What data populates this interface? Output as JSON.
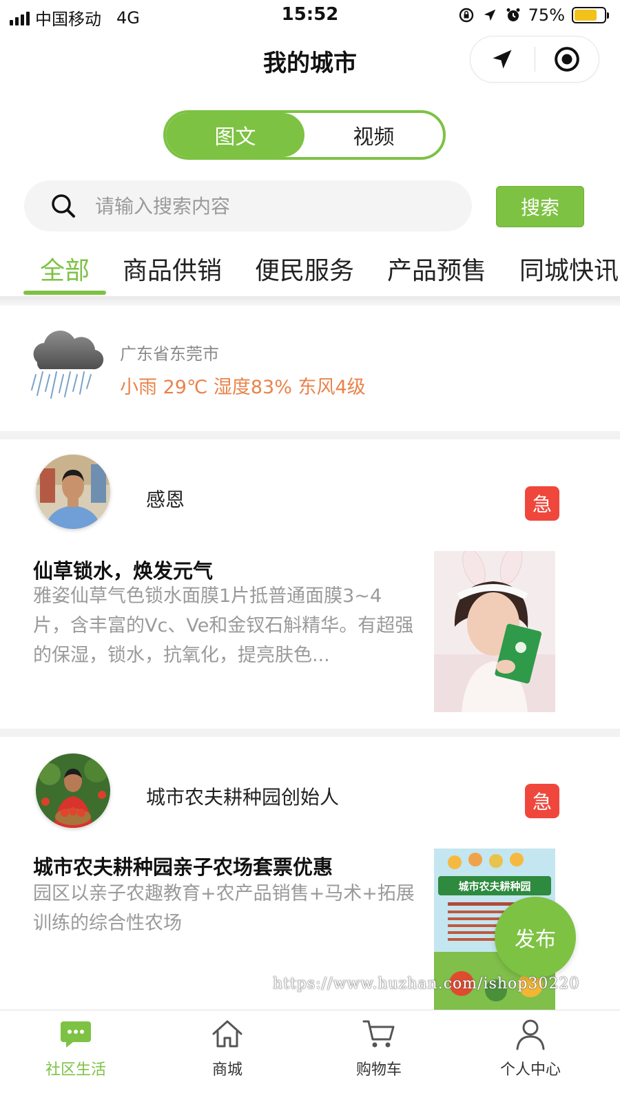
{
  "status_bar": {
    "carrier": "中国移动",
    "network": "4G",
    "time": "15:52",
    "battery": "75%",
    "battery_level": 0.75
  },
  "nav": {
    "title": "我的城市",
    "icons": [
      "location-arrow-icon",
      "target-icon"
    ]
  },
  "view_toggle": {
    "options": [
      "图文",
      "视频"
    ],
    "selected": "图文"
  },
  "search": {
    "placeholder": "请输入搜索内容",
    "button_label": "搜索"
  },
  "category_tabs": {
    "items": [
      "全部",
      "商品供销",
      "便民服务",
      "产品预售",
      "同城快讯"
    ],
    "selected": "全部"
  },
  "weather": {
    "location": "广东省东莞市",
    "detail": "小雨 29℃ 湿度83% 东风4级",
    "icon": "rain-cloud-icon"
  },
  "posts": [
    {
      "author": "感恩",
      "badge": "急",
      "title": "仙草锁水，焕发元气",
      "body": "雅姿仙草气色锁水面膜1片抵普通面膜3~4片，含丰富的Vc、Ve和金钗石斛精华。有超强的保湿，锁水，抗氧化，提亮肤色..."
    },
    {
      "author": "城市农夫耕种园创始人",
      "badge": "急",
      "title": "城市农夫耕种园亲子农场套票优惠",
      "body": "园区以亲子农趣教育+农产品销售+马术+拓展训练的综合性农场",
      "thumb_heading": "城市农夫耕种园"
    }
  ],
  "fab_label": "发布",
  "watermark": "https://www.huzhan.com/ishop30220",
  "bottom_tabs": {
    "items": [
      {
        "label": "社区生活",
        "icon": "chat-bubble-icon"
      },
      {
        "label": "商城",
        "icon": "home-icon"
      },
      {
        "label": "购物车",
        "icon": "cart-icon"
      },
      {
        "label": "个人中心",
        "icon": "user-icon"
      }
    ],
    "selected": "社区生活"
  },
  "colors": {
    "accent": "#7dc243",
    "weather_text": "#e8834b",
    "urgent": "#f0473c"
  }
}
